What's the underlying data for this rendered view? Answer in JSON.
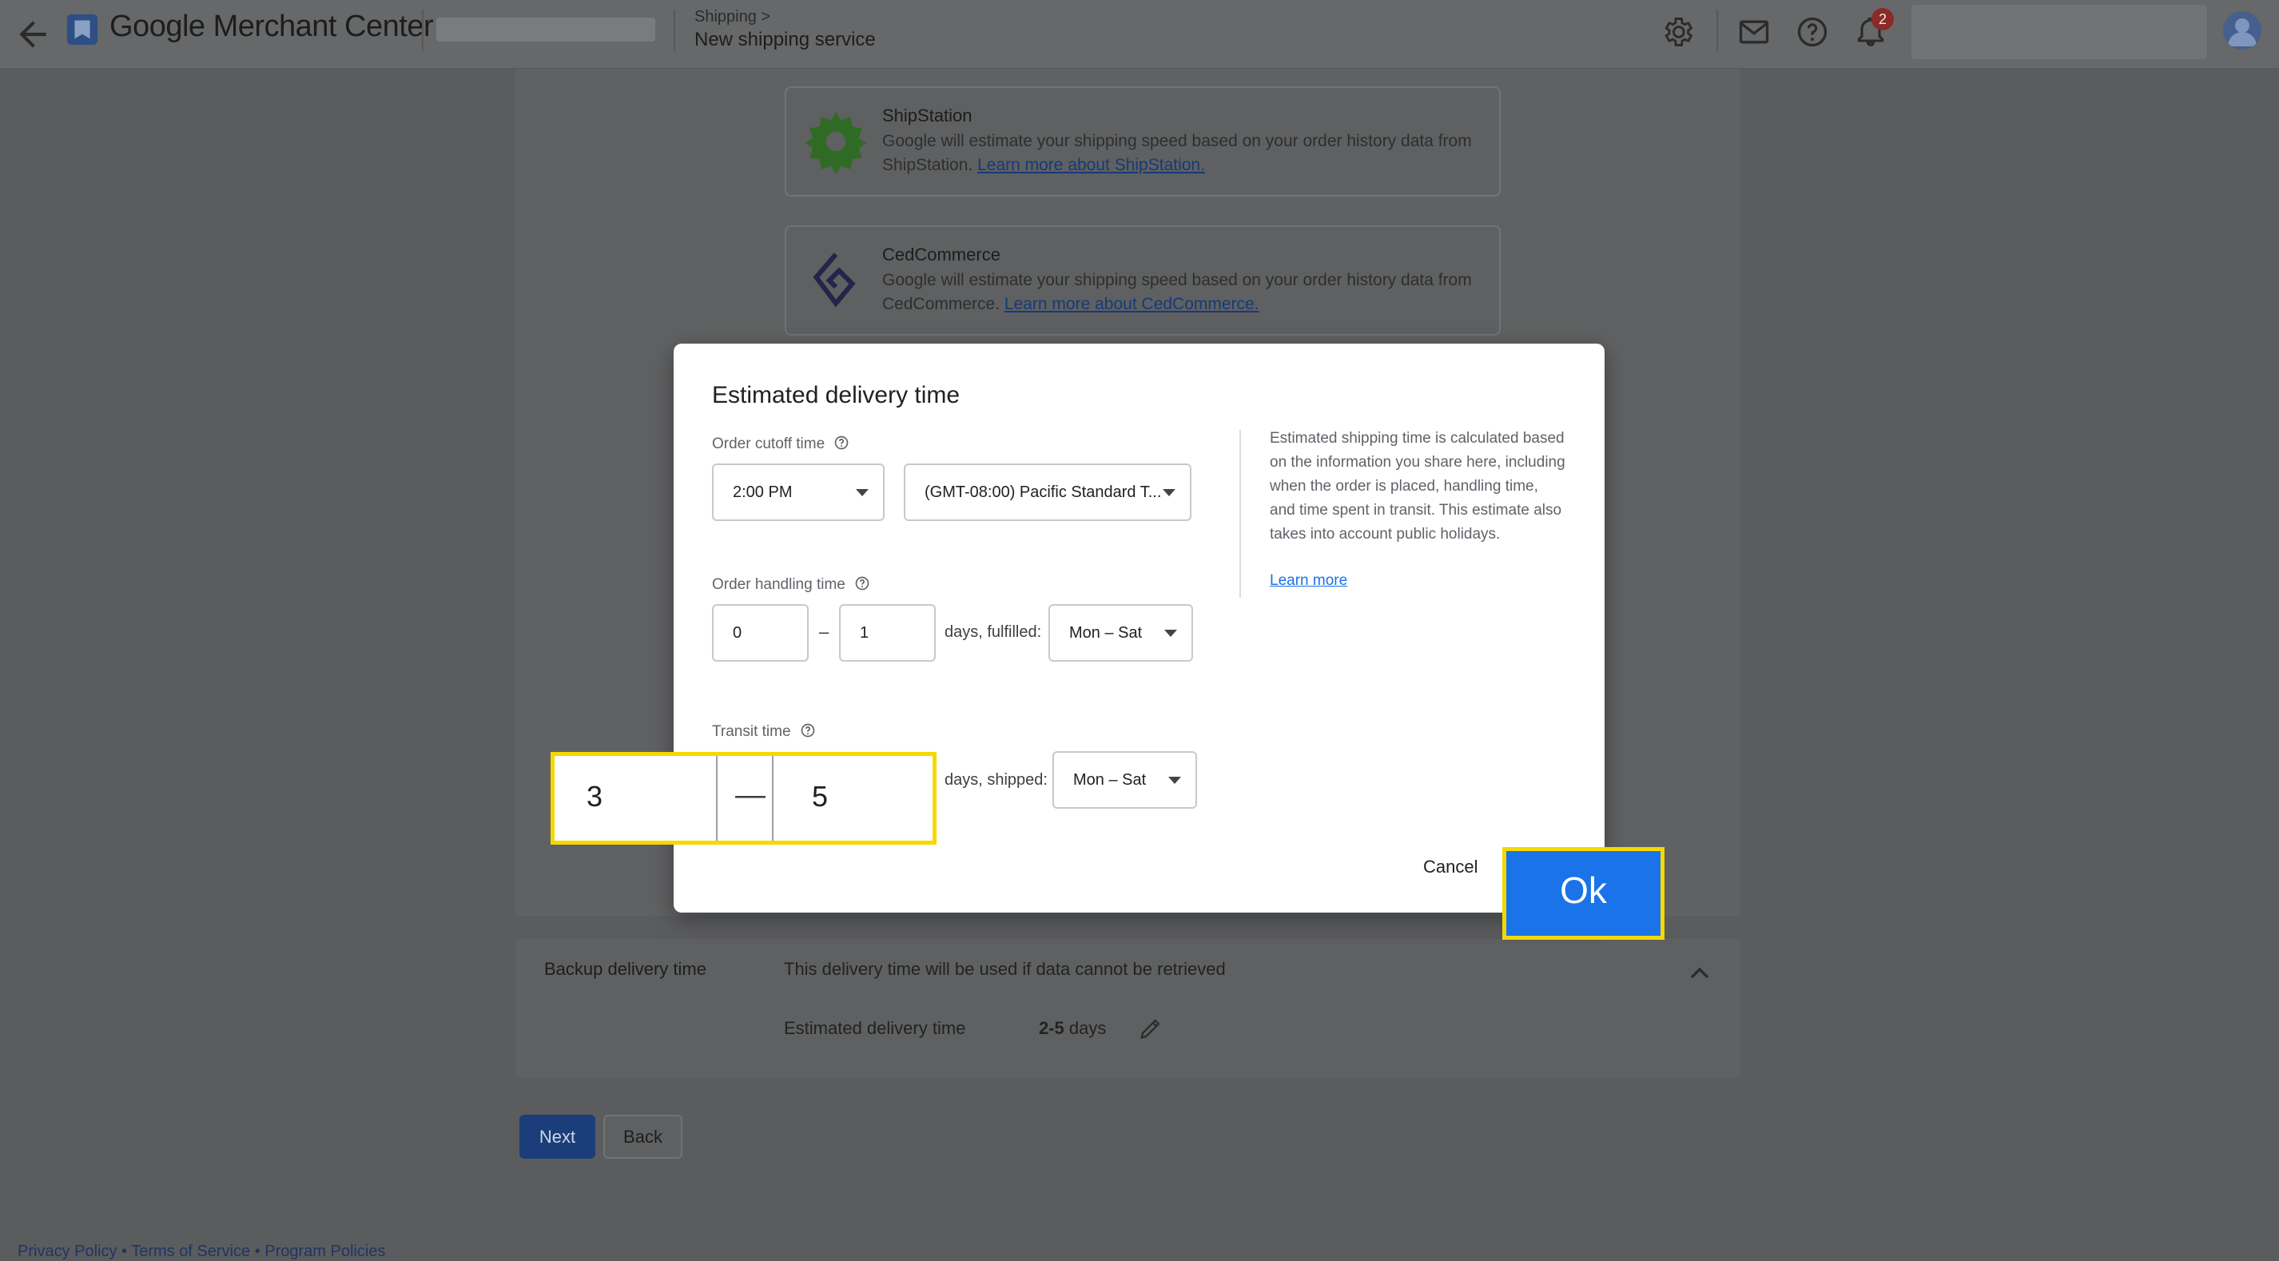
{
  "header": {
    "app_name": "Google Merchant Center",
    "breadcrumb_parent": "Shipping",
    "breadcrumb_chevron": ">",
    "page_title": "New shipping service",
    "notification_count": "2"
  },
  "providers": [
    {
      "name": "ShipStation",
      "desc": "Google will estimate your shipping speed based on your order history data from ShipStation.",
      "link": "Learn more about ShipStation."
    },
    {
      "name": "CedCommerce",
      "desc": "Google will estimate your shipping speed based on your order history data from CedCommerce.",
      "link": "Learn more about CedCommerce."
    }
  ],
  "dialog": {
    "title": "Estimated delivery time",
    "cutoff_label": "Order cutoff time",
    "cutoff_time": "2:00 PM",
    "timezone": "(GMT-08:00) Pacific Standard T...",
    "handling_label": "Order handling time",
    "handling_min": "0",
    "handling_max": "1",
    "dash": "–",
    "fulfilled_label": "days, fulfilled:",
    "fulfilled_days": "Mon – Sat",
    "transit_label": "Transit time",
    "transit_min": "3",
    "transit_max": "5",
    "transit_dash": "—",
    "shipped_label": "days, shipped:",
    "shipped_days": "Mon – Sat",
    "info": "Estimated shipping time is calculated based on the information you share here, including when the order is placed, handling time, and time spent in transit. This estimate also takes into account public holidays.",
    "learn_more": "Learn more",
    "cancel": "Cancel",
    "ok": "Ok"
  },
  "backup": {
    "title": "Backup delivery time",
    "desc": "This delivery time will be used if data cannot be retrieved",
    "est_label": "Estimated delivery time",
    "days_value": "2-5",
    "days_unit": " days"
  },
  "actions": {
    "next": "Next",
    "back": "Back"
  },
  "footer": {
    "text": "Privacy Policy • Terms of Service • Program Policies"
  },
  "colors": {
    "primary": "#1a73e8",
    "highlight": "#f5d800",
    "overlay_bg": "#5b5c5e"
  }
}
